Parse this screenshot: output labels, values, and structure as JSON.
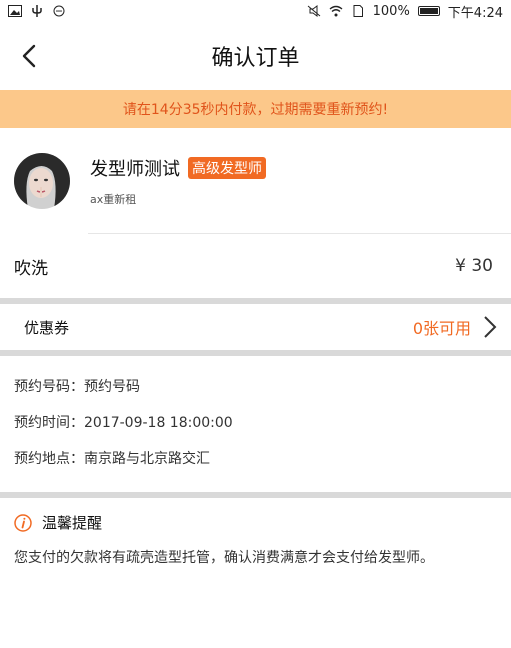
{
  "status_bar": {
    "battery": "100%",
    "time": "下午4:24"
  },
  "header": {
    "title": "确认订单"
  },
  "banner": {
    "text": "请在14分35秒内付款，过期需要重新预约!"
  },
  "stylist": {
    "name": "发型师测试",
    "level": "高级发型师",
    "sub": "ax重新租"
  },
  "service": {
    "name": "吹洗",
    "price": "¥ 30"
  },
  "coupon": {
    "label": "优惠券",
    "available": "0张可用"
  },
  "details": {
    "number": "预约号码：预约号码",
    "time": "预约时间：2017-09-18  18:00:00",
    "location": "预约地点：南京路与北京路交汇"
  },
  "notice": {
    "title": "温馨提醒",
    "text": "您支付的欠款将有疏壳造型托管，确认消费满意才会支付给发型师。"
  },
  "colors": {
    "accent": "#f16a23",
    "banner_bg": "#fcc88a",
    "banner_text": "#e0541b"
  }
}
